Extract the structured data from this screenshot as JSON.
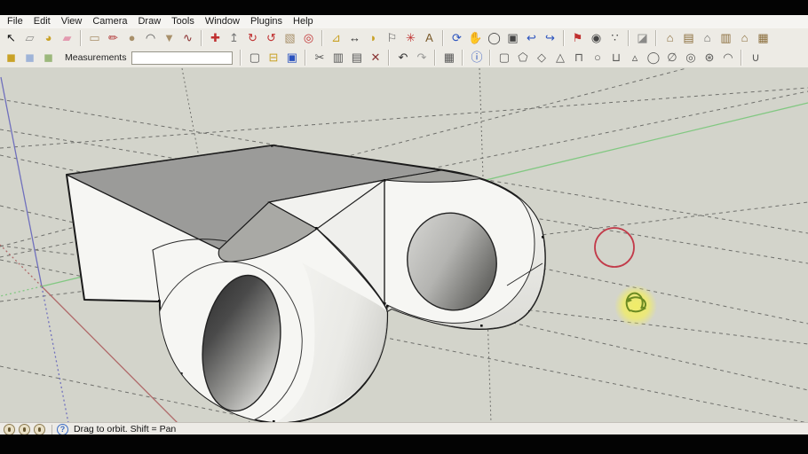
{
  "menu": {
    "items": [
      "File",
      "Edit",
      "View",
      "Camera",
      "Draw",
      "Tools",
      "Window",
      "Plugins",
      "Help"
    ]
  },
  "toolbar_row1_groups": [
    [
      {
        "name": "select-tool",
        "glyph": "↖",
        "color": "#111111"
      },
      {
        "name": "make-component-tool",
        "glyph": "▱",
        "color": "#8f8f8c"
      },
      {
        "name": "paint-bucket-tool",
        "glyph": "◕",
        "color": "#c9a227"
      },
      {
        "name": "eraser-tool",
        "glyph": "▰",
        "color": "#e39bb0"
      }
    ],
    [
      {
        "name": "rectangle-tool",
        "glyph": "▭",
        "color": "#a8906a"
      },
      {
        "name": "line-tool",
        "glyph": "✏",
        "color": "#b03030"
      },
      {
        "name": "circle-tool",
        "glyph": "●",
        "color": "#a8906a"
      },
      {
        "name": "arc-tool",
        "glyph": "◠",
        "color": "#555555"
      },
      {
        "name": "polygon-tool",
        "glyph": "▼",
        "color": "#a8906a"
      },
      {
        "name": "freehand-tool",
        "glyph": "∿",
        "color": "#8a3030"
      }
    ],
    [
      {
        "name": "move-tool",
        "glyph": "✚",
        "color": "#c03030"
      },
      {
        "name": "push-pull-tool",
        "glyph": "↥",
        "color": "#777777"
      },
      {
        "name": "rotate-tool",
        "glyph": "↻",
        "color": "#c03030"
      },
      {
        "name": "follow-me-tool",
        "glyph": "↺",
        "color": "#c03030"
      },
      {
        "name": "scale-tool",
        "glyph": "▧",
        "color": "#a8906a"
      },
      {
        "name": "offset-tool",
        "glyph": "◎",
        "color": "#c03030"
      }
    ],
    [
      {
        "name": "tape-measure-tool",
        "glyph": "⊿",
        "color": "#c9a227"
      },
      {
        "name": "dimension-tool",
        "glyph": "↔",
        "color": "#333333"
      },
      {
        "name": "protractor-tool",
        "glyph": "◗",
        "color": "#c9a227"
      },
      {
        "name": "text-tool",
        "glyph": "⚐",
        "color": "#555555"
      },
      {
        "name": "axes-tool",
        "glyph": "✳",
        "color": "#c03030"
      },
      {
        "name": "3d-text-tool",
        "glyph": "A",
        "color": "#7a5a2a"
      }
    ],
    [
      {
        "name": "orbit-tool",
        "glyph": "⟳",
        "color": "#2a52be"
      },
      {
        "name": "pan-tool",
        "glyph": "✋",
        "color": "#d2a36a"
      },
      {
        "name": "zoom-tool",
        "glyph": "◯",
        "color": "#444444"
      },
      {
        "name": "zoom-extents-tool",
        "glyph": "▣",
        "color": "#444444"
      },
      {
        "name": "previous-view-tool",
        "glyph": "↩",
        "color": "#2a52be"
      },
      {
        "name": "next-view-tool",
        "glyph": "↪",
        "color": "#2a52be"
      }
    ],
    [
      {
        "name": "position-camera-tool",
        "glyph": "⚑",
        "color": "#c03030"
      },
      {
        "name": "look-around-tool",
        "glyph": "◉",
        "color": "#444444"
      },
      {
        "name": "walk-tool",
        "glyph": "∵",
        "color": "#444444"
      }
    ],
    [
      {
        "name": "section-plane-tool",
        "glyph": "◪",
        "color": "#8a8a88"
      }
    ],
    [
      {
        "name": "view-iso",
        "glyph": "⌂",
        "color": "#8a6d3b"
      },
      {
        "name": "view-top",
        "glyph": "▤",
        "color": "#8a6d3b"
      },
      {
        "name": "view-front",
        "glyph": "⌂",
        "color": "#6b6b68"
      },
      {
        "name": "view-right",
        "glyph": "▥",
        "color": "#8a6d3b"
      },
      {
        "name": "view-back",
        "glyph": "⌂",
        "color": "#8a6d3b"
      },
      {
        "name": "view-left",
        "glyph": "▦",
        "color": "#8a6d3b"
      }
    ]
  ],
  "toolbar_row2_styles": [
    {
      "name": "style-shaded",
      "glyph": "◼",
      "color": "#c9a227"
    },
    {
      "name": "style-xray",
      "glyph": "◼",
      "color": "#9fb4d8"
    },
    {
      "name": "style-wireframe",
      "glyph": "◼",
      "color": "#9cb87c"
    }
  ],
  "measurements": {
    "label": "Measurements",
    "value": "",
    "placeholder": ""
  },
  "toolbar_row2_groups": [
    [
      {
        "name": "new-file-button",
        "glyph": "▢",
        "color": "#555555"
      },
      {
        "name": "open-file-button",
        "glyph": "⊟",
        "color": "#c9a227"
      },
      {
        "name": "save-file-button",
        "glyph": "▣",
        "color": "#2a52be"
      }
    ],
    [
      {
        "name": "cut-button",
        "glyph": "✂",
        "color": "#555555"
      },
      {
        "name": "copy-button",
        "glyph": "▥",
        "color": "#555555"
      },
      {
        "name": "paste-button",
        "glyph": "▤",
        "color": "#555555"
      },
      {
        "name": "erase-button",
        "glyph": "✕",
        "color": "#883333"
      }
    ],
    [
      {
        "name": "undo-button",
        "glyph": "↶",
        "color": "#333333"
      },
      {
        "name": "redo-button",
        "glyph": "↷",
        "color": "#9a9a98"
      }
    ],
    [
      {
        "name": "print-button",
        "glyph": "▦",
        "color": "#555555"
      }
    ],
    [
      {
        "name": "model-info-button",
        "glyph": "ⓘ",
        "color": "#2a52be"
      }
    ],
    [
      {
        "name": "shape-box",
        "glyph": "▢",
        "color": "#5a5a58"
      },
      {
        "name": "shape-pentagon",
        "glyph": "⬠",
        "color": "#5a5a58"
      },
      {
        "name": "shape-wedge",
        "glyph": "◇",
        "color": "#5a5a58"
      },
      {
        "name": "shape-pyramid",
        "glyph": "△",
        "color": "#5a5a58"
      },
      {
        "name": "shape-half-cylinder",
        "glyph": "⊓",
        "color": "#5a5a58"
      },
      {
        "name": "shape-sphere",
        "glyph": "○",
        "color": "#5a5a58"
      },
      {
        "name": "shape-cylinder",
        "glyph": "⊔",
        "color": "#5a5a58"
      },
      {
        "name": "shape-cone",
        "glyph": "▵",
        "color": "#5a5a58"
      },
      {
        "name": "shape-rounded-box",
        "glyph": "◯",
        "color": "#5a5a58"
      },
      {
        "name": "shape-ellipse",
        "glyph": "∅",
        "color": "#5a5a58"
      },
      {
        "name": "shape-torus",
        "glyph": "◎",
        "color": "#5a5a58"
      },
      {
        "name": "shape-geodesic-sphere",
        "glyph": "⊛",
        "color": "#5a5a58"
      },
      {
        "name": "shape-dome",
        "glyph": "◠",
        "color": "#5a5a58"
      }
    ],
    [
      {
        "name": "shape-u-tube",
        "glyph": "∪",
        "color": "#5a5a58"
      }
    ]
  ],
  "statusbar": {
    "icons": [
      {
        "name": "status-icon-1"
      },
      {
        "name": "status-icon-2"
      },
      {
        "name": "status-icon-3"
      }
    ],
    "help_glyph": "?",
    "message": "Drag to orbit.  Shift = Pan"
  },
  "viewport": {
    "tool_active": "orbit",
    "colors": {
      "background": "#d3d4cb",
      "face": "#f6f6f3",
      "top_face": "#9b9b99",
      "top_face_sliver": "#a2a29e",
      "top_face_step": "#a9a9a5",
      "outline": "#1a1a1a",
      "axis_green": "#82c882",
      "axis_blue": "#7070bd",
      "axis_red": "#b06a6a",
      "guide": "#4a4a48",
      "annotation_red": "#c23b4a",
      "highlight_yellow": "#f2ee62",
      "cursor_green": "#6b8a22"
    },
    "annotations": {
      "red_circle": {
        "cx": "692",
        "cy": "279",
        "r": "22"
      },
      "orbit_cursor": {
        "cx": "716",
        "cy": "345"
      }
    }
  }
}
